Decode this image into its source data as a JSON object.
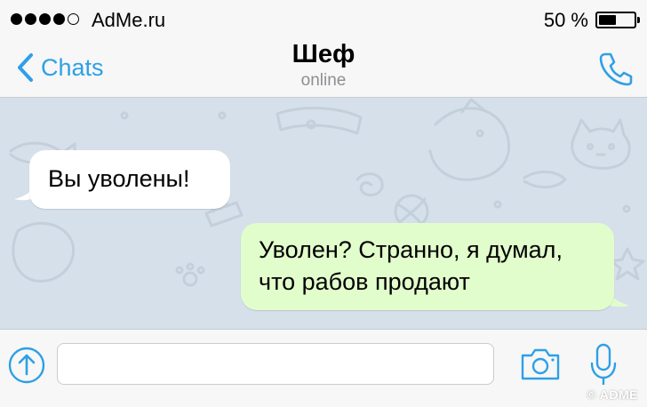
{
  "status_bar": {
    "signal_dots_filled": 4,
    "signal_dots_total": 5,
    "carrier": "AdMe.ru",
    "battery_text": "50 %",
    "battery_level": 0.5
  },
  "nav": {
    "back_label": "Chats",
    "title": "Шеф",
    "subtitle": "online",
    "back_icon": "chevron-left-icon",
    "call_icon": "phone-icon"
  },
  "messages": {
    "incoming": {
      "text": "Вы уволены!"
    },
    "outgoing": {
      "line1": "Уволен? Странно, я думал,",
      "line2": "что рабов продают"
    }
  },
  "input_bar": {
    "placeholder": "",
    "value": "",
    "attach_icon": "arrow-up-circle-icon",
    "camera_icon": "camera-icon",
    "mic_icon": "microphone-icon"
  },
  "watermark": "© ADME",
  "colors": {
    "accent": "#2ea0e6",
    "chat_background": "#d6e0ea",
    "bubble_incoming": "#ffffff",
    "bubble_outgoing": "#e2fdcc",
    "bar_background": "#f7f7f7"
  }
}
